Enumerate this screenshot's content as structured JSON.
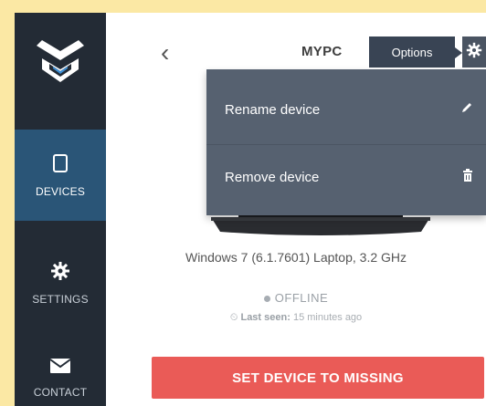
{
  "header": {
    "title": "MYPC",
    "options_label": "Options"
  },
  "sidebar": {
    "items": [
      {
        "label": "DEVICES",
        "icon": "tablet-icon",
        "active": true
      },
      {
        "label": "SETTINGS",
        "icon": "gear-icon",
        "active": false
      },
      {
        "label": "CONTACT",
        "icon": "envelope-icon",
        "active": false
      }
    ]
  },
  "menu": {
    "items": [
      {
        "label": "Rename device",
        "icon": "pencil-icon"
      },
      {
        "label": "Remove device",
        "icon": "trash-icon"
      }
    ]
  },
  "device": {
    "description": "Windows 7 (6.1.7601) Laptop, 3.2 GHz",
    "status": "OFFLINE",
    "last_seen_label": "Last seen:",
    "last_seen_value": "15 minutes ago"
  },
  "actions": {
    "missing_label": "SET DEVICE TO MISSING"
  },
  "colors": {
    "sidebar": "#232b35",
    "active_nav": "#2a5577",
    "menu": "#566170",
    "danger": "#ea5b57",
    "frame_border": "#fbe8a4"
  }
}
